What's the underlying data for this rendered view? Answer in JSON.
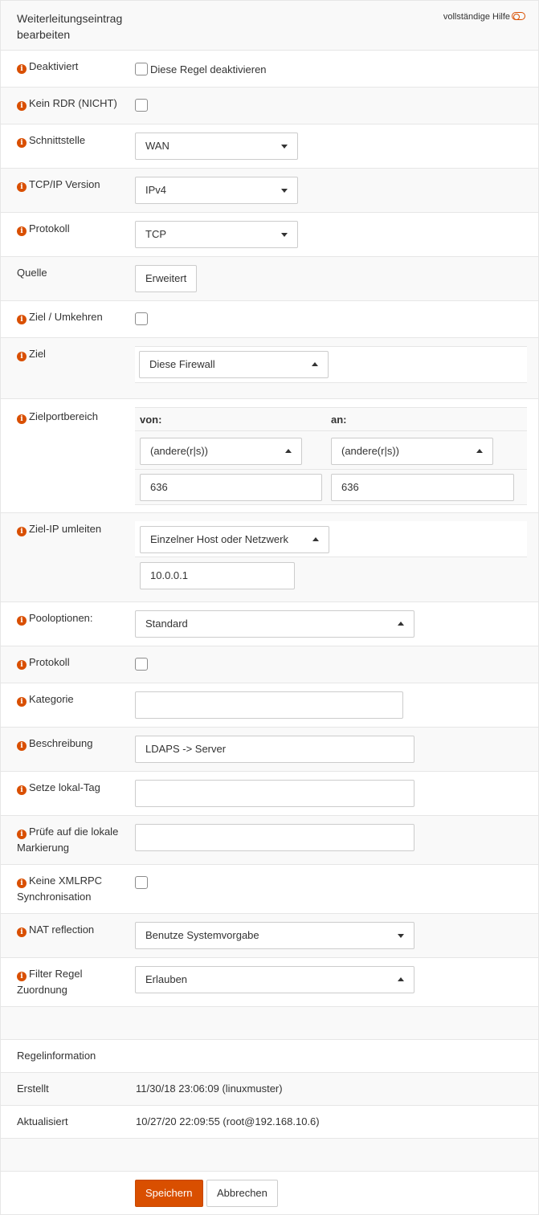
{
  "header": {
    "title": "Weiterleitungseintrag bearbeiten",
    "help_label": "vollständige Hilfe"
  },
  "fields": {
    "disabled": {
      "label": "Deaktiviert",
      "checkbox_text": "Diese Regel deaktivieren"
    },
    "nordr": {
      "label": "Kein RDR (NICHT)"
    },
    "interface": {
      "label": "Schnittstelle",
      "value": "WAN"
    },
    "ipversion": {
      "label": "TCP/IP Version",
      "value": "IPv4"
    },
    "protocol": {
      "label": "Protokoll",
      "value": "TCP"
    },
    "source": {
      "label": "Quelle",
      "button": "Erweitert"
    },
    "dest_invert": {
      "label": "Ziel / Umkehren"
    },
    "destination": {
      "label": "Ziel",
      "value": "Diese Firewall"
    },
    "dest_port": {
      "label": "Zielportbereich",
      "from_label": "von:",
      "to_label": "an:",
      "from_select": "(andere(r|s))",
      "to_select": "(andere(r|s))",
      "from_value": "636",
      "to_value": "636"
    },
    "target": {
      "label": "Ziel-IP umleiten",
      "select": "Einzelner Host oder Netzwerk",
      "value": "10.0.0.1"
    },
    "pool": {
      "label": "Pooloptionen:",
      "value": "Standard"
    },
    "log": {
      "label": "Protokoll"
    },
    "category": {
      "label": "Kategorie",
      "value": ""
    },
    "description": {
      "label": "Beschreibung",
      "value": "LDAPS -> Server"
    },
    "tag": {
      "label": "Setze lokal-Tag",
      "value": ""
    },
    "tagged": {
      "label": "Prüfe auf die lokale Markierung",
      "value": ""
    },
    "nosync": {
      "label": "Keine XMLRPC Synchronisation"
    },
    "natreflection": {
      "label": "NAT reflection",
      "value": "Benutze Systemvorgabe"
    },
    "filter_rule": {
      "label": "Filter Regel Zuordnung",
      "value": "Erlauben"
    }
  },
  "rule_info": {
    "heading": "Regelinformation",
    "created_label": "Erstellt",
    "created_value": "11/30/18 23:06:09 (linuxmuster)",
    "updated_label": "Aktualisiert",
    "updated_value": "10/27/20 22:09:55 (root@192.168.10.6)"
  },
  "actions": {
    "save": "Speichern",
    "cancel": "Abbrechen"
  },
  "colors": {
    "accent": "#d94f00",
    "border": "#e6e6e6",
    "row_alt": "#f9f9f9"
  },
  "icons": {
    "info": "info-icon",
    "toggle": "toggle-icon",
    "caret": "caret-icon"
  }
}
